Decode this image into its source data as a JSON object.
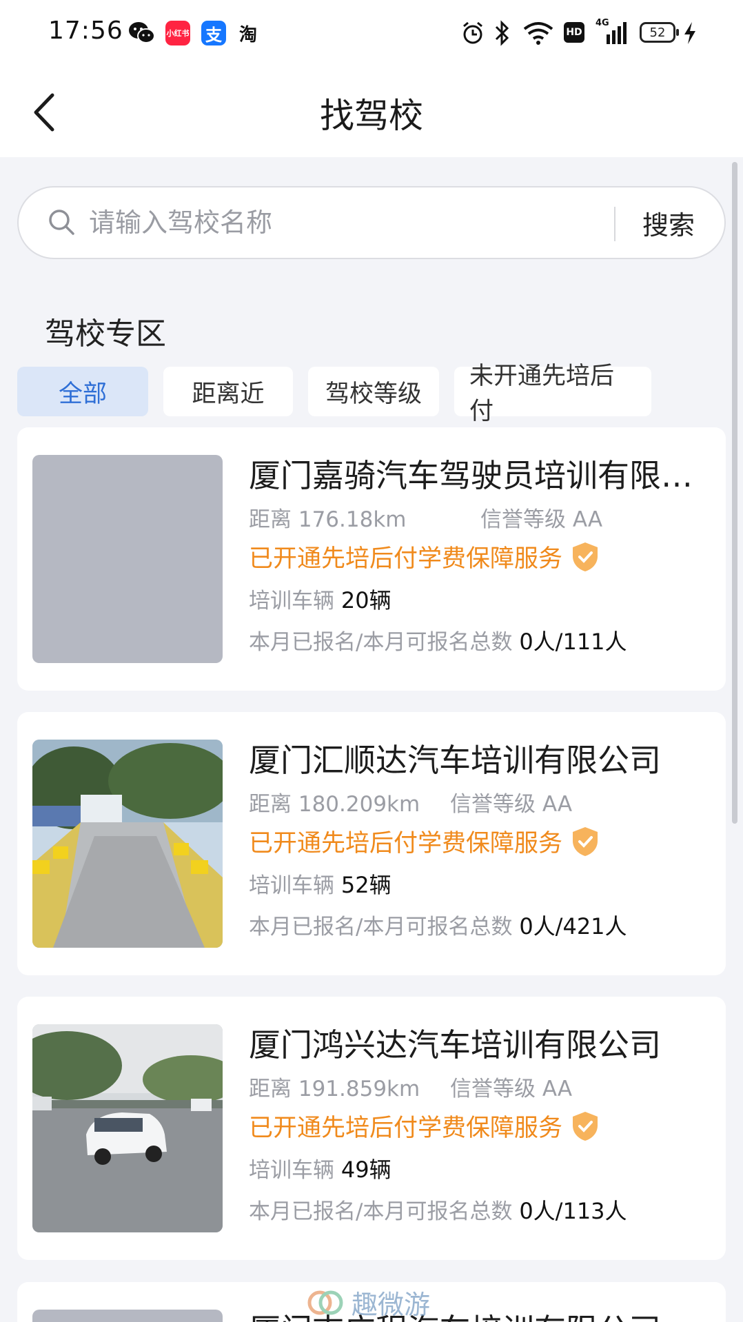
{
  "status_bar": {
    "time": "17:56",
    "apps": [
      "wechat-icon",
      "xiaohongshu-icon",
      "alipay-icon",
      "taobao-icon"
    ],
    "xiaohongshu_label": "小红书",
    "alipay_label": "支",
    "taobao_label": "淘",
    "hd_label": "HD",
    "network_label": "4G",
    "battery": "52"
  },
  "nav": {
    "title": "找驾校"
  },
  "search": {
    "placeholder": "请输入驾校名称",
    "button_label": "搜索"
  },
  "section": {
    "title": "驾校专区"
  },
  "filters": [
    {
      "label": "全部",
      "active": true
    },
    {
      "label": "距离近",
      "active": false
    },
    {
      "label": "驾校等级",
      "active": false
    },
    {
      "label": "未开通先培后付",
      "active": false
    }
  ],
  "labels": {
    "distance": "距离",
    "credit": "信誉等级",
    "vehicles": "培训车辆",
    "enrollment": "本月已报名/本月可报名总数"
  },
  "schools": [
    {
      "name": "厦门嘉骑汽车驾驶员培训有限公司",
      "distance": "176.18km",
      "credit": "AA",
      "service": "已开通先培后付学费保障服务",
      "vehicles": "20辆",
      "enrollment": "0人/111人",
      "photo": "placeholder"
    },
    {
      "name": "厦门汇顺达汽车培训有限公司",
      "distance": "180.209km",
      "credit": "AA",
      "service": "已开通先培后付学费保障服务",
      "vehicles": "52辆",
      "enrollment": "0人/421人",
      "photo": "training-ramp"
    },
    {
      "name": "厦门鸿兴达汽车培训有限公司",
      "distance": "191.859km",
      "credit": "AA",
      "service": "已开通先培后付学费保障服务",
      "vehicles": "49辆",
      "enrollment": "0人/113人",
      "photo": "training-car"
    },
    {
      "name": "厦门志广程汽车培训有限公司",
      "photo": "placeholder"
    }
  ],
  "watermark": "趣微游",
  "colors": {
    "accent_blue": "#2f6fd6",
    "active_tab_bg": "#dbe6f8",
    "service_orange": "#f08a1c",
    "page_bg": "#f3f4f8"
  }
}
